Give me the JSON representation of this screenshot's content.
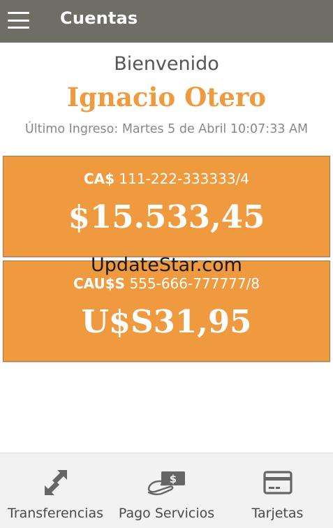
{
  "header": {
    "title": "Cuentas",
    "menu_icon": "hamburger-menu-icon",
    "background": "#6e6e66"
  },
  "welcome": {
    "greeting": "Bienvenido",
    "user_name": "Ignacio Otero",
    "last_login": "Último Ingreso: Martes 5 de Abril 10:07:33 AM"
  },
  "accounts": [
    {
      "type": "CA$",
      "number": "111-222-333333/4",
      "balance": "$15.533,45"
    },
    {
      "type": "CAU$S",
      "number": "555-666-777777/8",
      "balance": "U$S31,95"
    }
  ],
  "watermark": "UpdateStar.com",
  "bottom_nav": [
    {
      "label": "Transferencias",
      "icon": "transfer-arrows-icon"
    },
    {
      "label": "Pago Servicios",
      "icon": "hand-with-money-icon"
    },
    {
      "label": "Tarjetas",
      "icon": "credit-card-icon"
    }
  ],
  "colors": {
    "accent": "#ef9a3f",
    "header": "#6e6e66",
    "nav_background": "#f2f2f2",
    "icon_gray": "#666666"
  }
}
